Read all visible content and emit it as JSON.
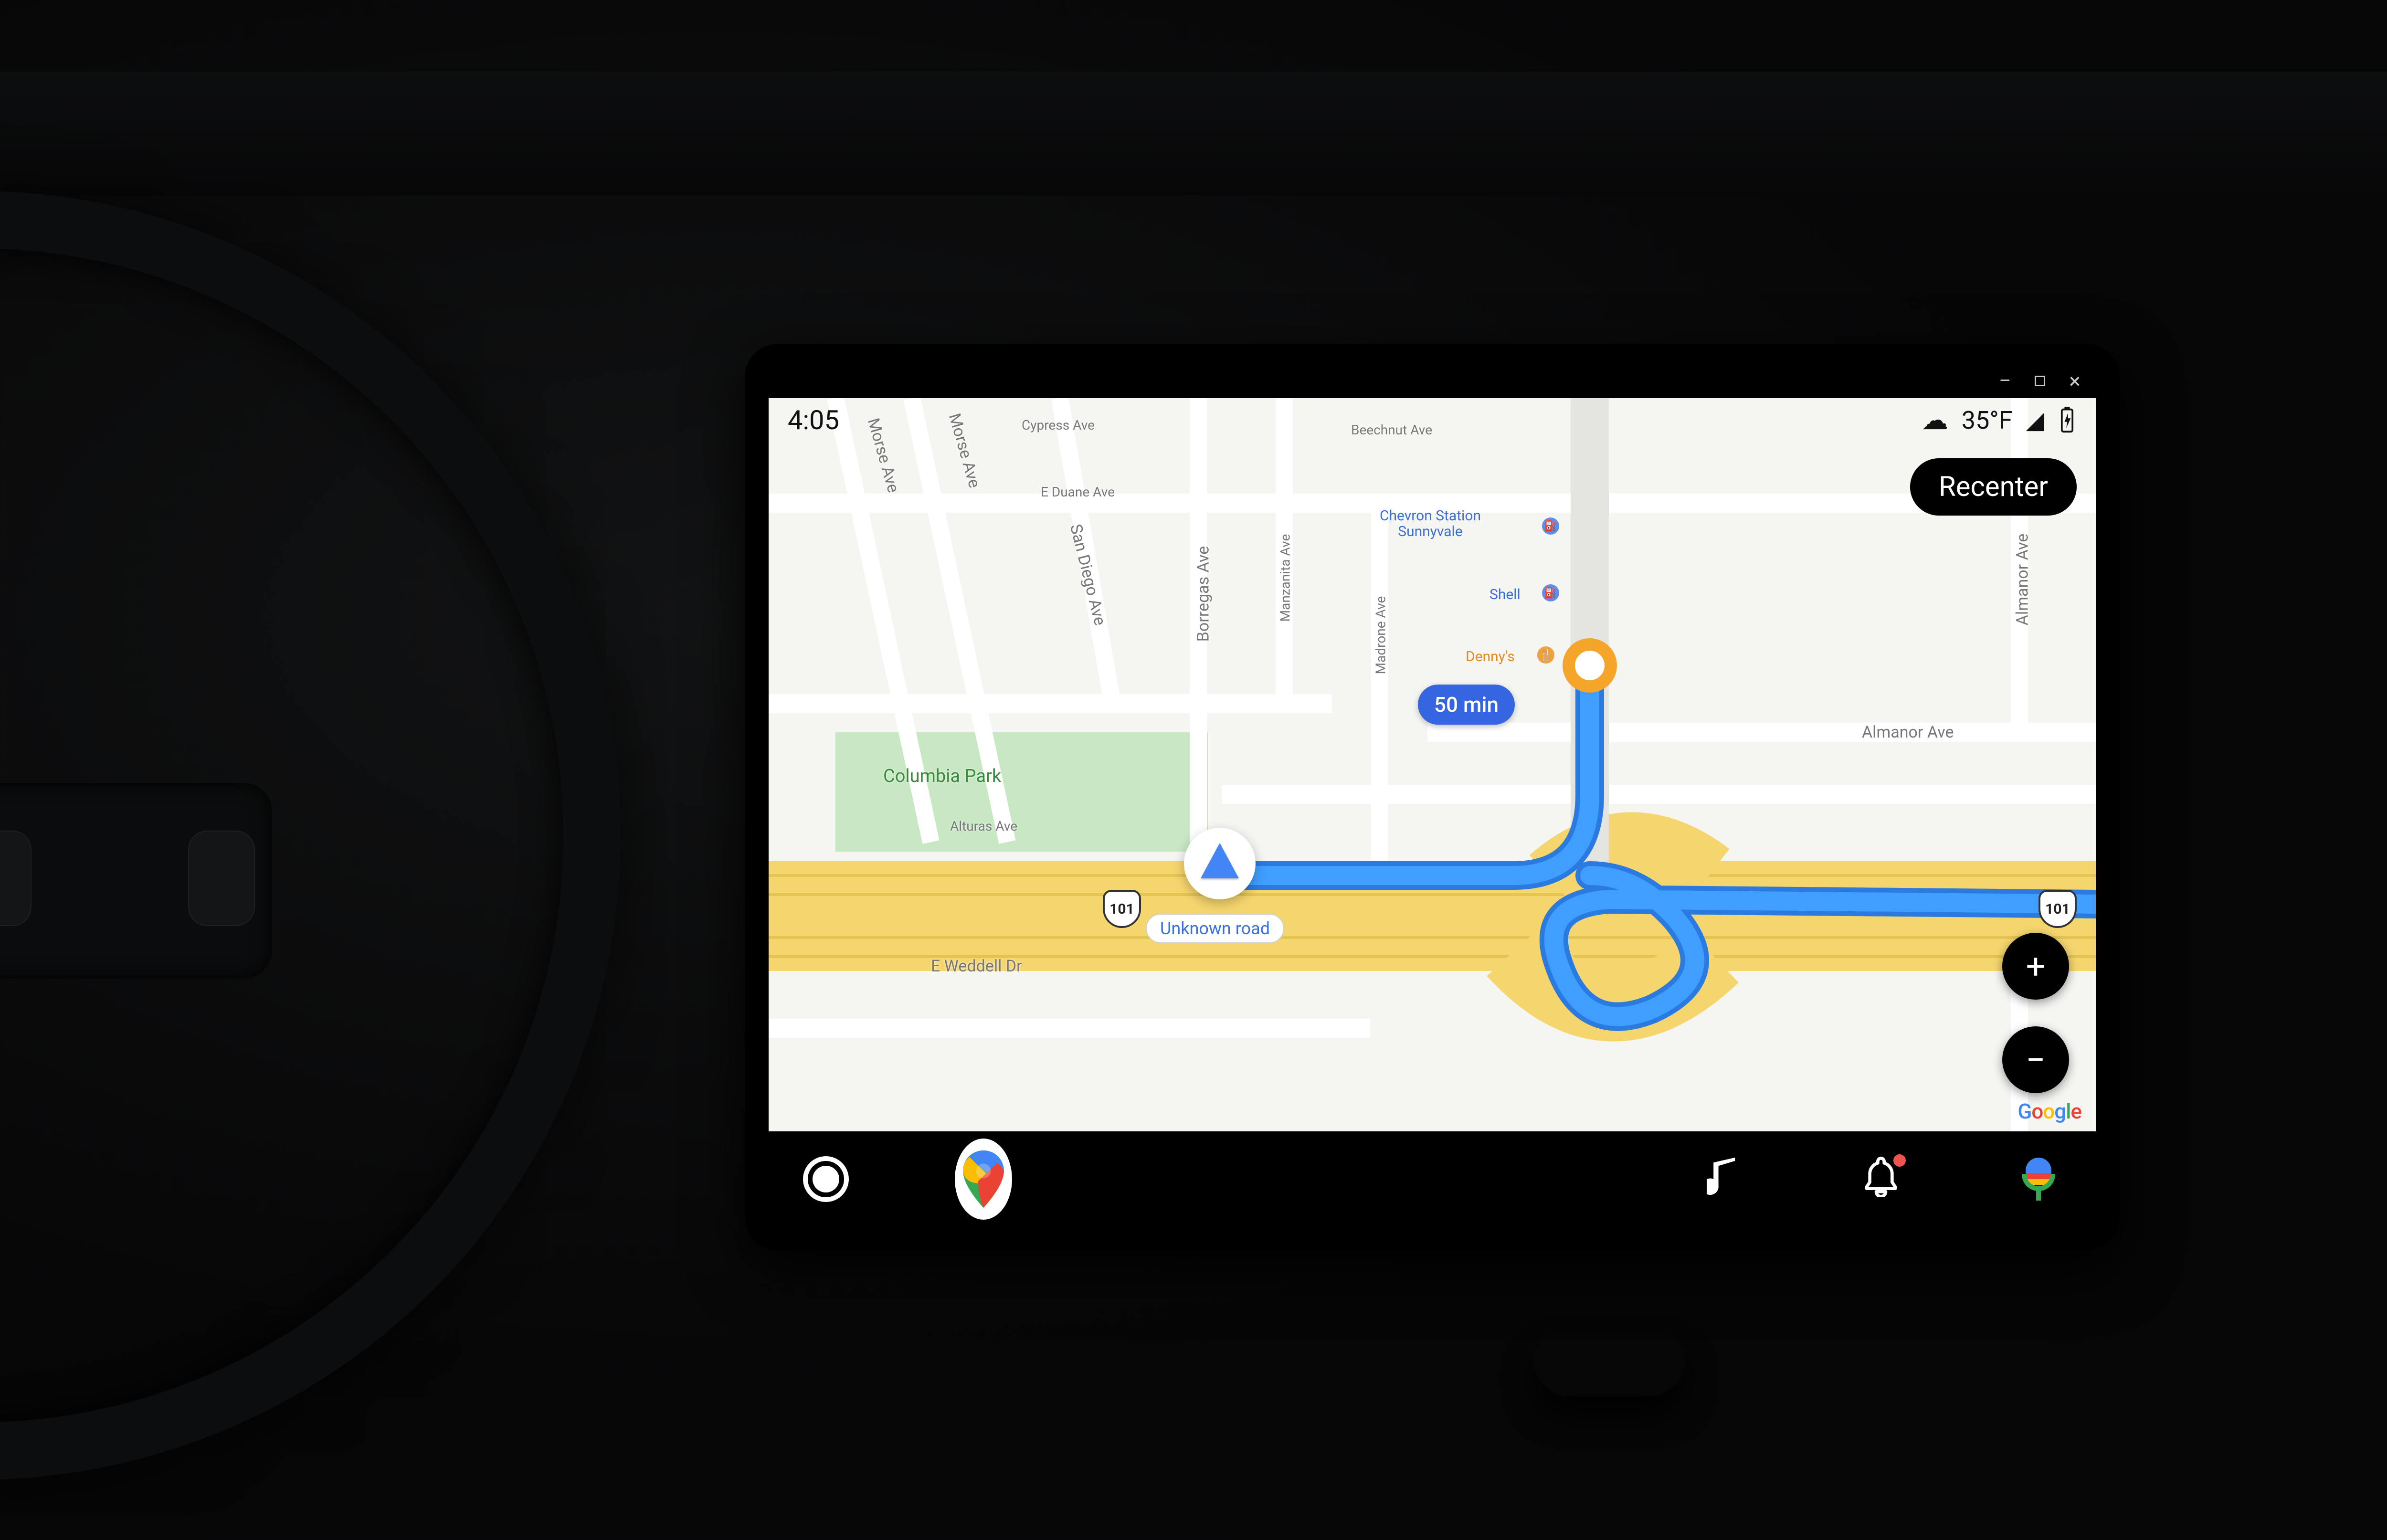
{
  "window": {
    "minimize": "–",
    "maximize": "◻",
    "close": "×"
  },
  "status": {
    "time": "4:05",
    "weather_icon": "cloud-icon",
    "temperature": "35°F",
    "signal_icon": "cell-signal-icon",
    "battery_icon": "battery-charging-icon"
  },
  "map": {
    "recenter_label": "Recenter",
    "zoom_in_label": "+",
    "zoom_out_label": "−",
    "current_road_label": "Unknown road",
    "traffic_eta": "50 min",
    "highway_shield_1": "101",
    "highway_shield_2": "101",
    "park_label": "Columbia Park",
    "attribution": "Google",
    "roads": [
      "Morse Ave",
      "Morse Ave",
      "Cypress Ave",
      "E Duane Ave",
      "San Diego Ave",
      "Borregas Ave",
      "Manzanita Ave",
      "Beechnut Ave",
      "Madrone Ave",
      "Almanor Ave",
      "Almanor Ave",
      "Alturas Ave",
      "E Weddell Dr"
    ],
    "pois": {
      "chevron": "Chevron Station\nSunnyvale",
      "shell": "Shell",
      "dennys": "Denny's"
    }
  },
  "navbar": {
    "launcher_icon": "app-launcher-icon",
    "maps_icon": "google-maps-icon",
    "music_icon": "music-note-icon",
    "notifications_icon": "bell-icon",
    "voice_icon": "google-assistant-mic-icon"
  }
}
